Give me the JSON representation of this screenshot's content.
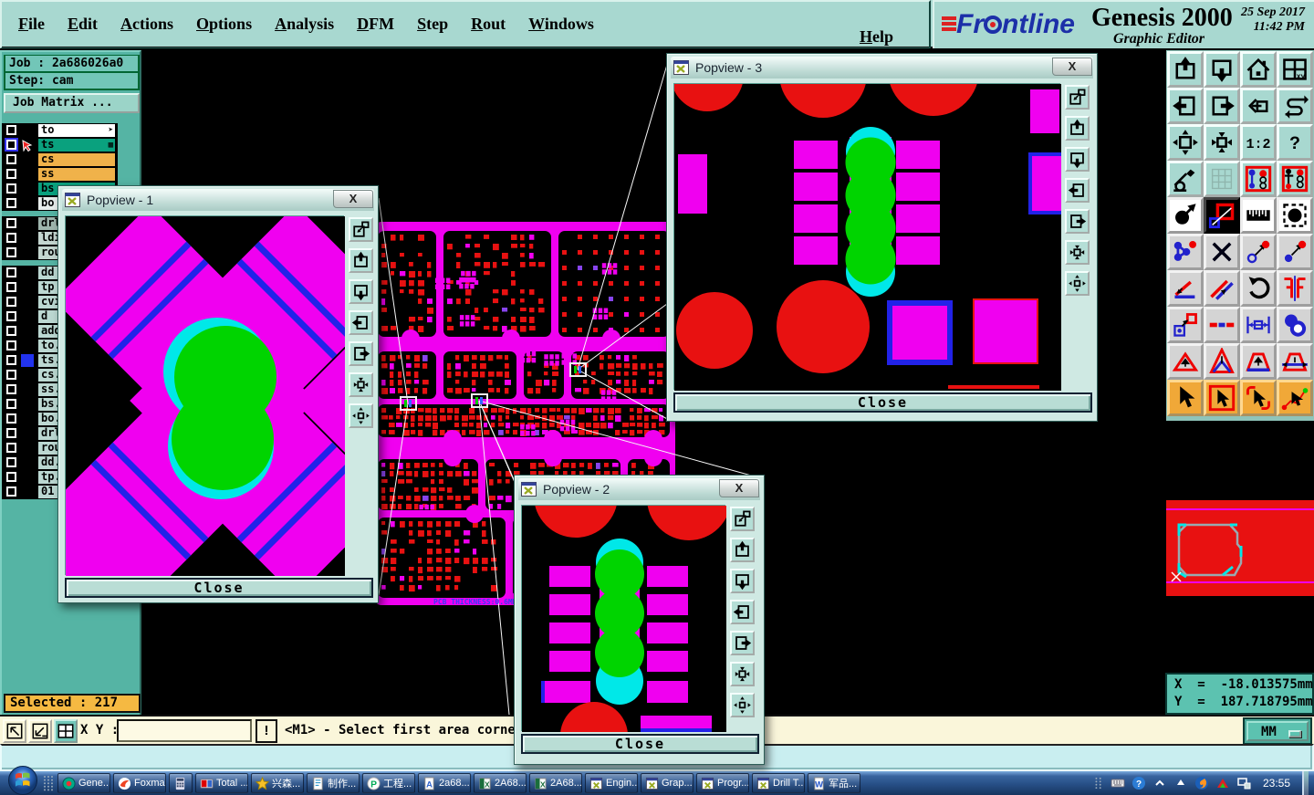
{
  "menu": {
    "items": [
      "File",
      "Edit",
      "Actions",
      "Options",
      "Analysis",
      "DFM",
      "Step",
      "Rout",
      "Windows"
    ],
    "help": "Help"
  },
  "brand": {
    "logo": "Frontline",
    "product": "Genesis 2000",
    "date": "25 Sep 2017",
    "time": "11:42 PM",
    "subtitle": "Graphic Editor"
  },
  "job": {
    "job_label": "Job : 2a686026a0",
    "step_label": "Step: cam",
    "matrix_button": "Job Matrix ..."
  },
  "layers": {
    "groups": [
      {
        "rows": [
          {
            "label": "to",
            "bg": "#ffffff",
            "right_icon": "cursor-small-icon"
          },
          {
            "label": "ts",
            "bg": "#0aa17e",
            "selected": true,
            "marker": "red-cursor",
            "right_icon": "grid-small-icon"
          },
          {
            "label": "cs",
            "bg": "#f0b24a"
          },
          {
            "label": "ss",
            "bg": "#f0b24a"
          },
          {
            "label": "bs",
            "bg": "#0aa17e"
          },
          {
            "label": "bo",
            "bg": "#e9efed"
          }
        ]
      },
      {
        "rows": [
          {
            "label": "drl",
            "bg": "#9fb6ae"
          },
          {
            "label": "ldi",
            "bg": "#c4d6d0"
          },
          {
            "label": "rou",
            "bg": "#c4d6d0"
          }
        ]
      },
      {
        "rows": [
          {
            "label": "dd",
            "bg": "#bcd8d2"
          },
          {
            "label": "tp",
            "bg": "#bcd8d2"
          },
          {
            "label": "cvi",
            "bg": "#bcd8d2"
          },
          {
            "label": "d",
            "bg": "#bcd8d2"
          },
          {
            "label": "add",
            "bg": "#bcd8d2"
          },
          {
            "label": "to.",
            "bg": "#bcd8d2"
          },
          {
            "label": "ts.",
            "bg": "#bcd8d2",
            "marker": "blue-square"
          },
          {
            "label": "cs.",
            "bg": "#bcd8d2"
          },
          {
            "label": "ss.",
            "bg": "#bcd8d2"
          },
          {
            "label": "bs.",
            "bg": "#bcd8d2"
          },
          {
            "label": "bo.",
            "bg": "#bcd8d2"
          },
          {
            "label": "drl",
            "bg": "#bcd8d2"
          },
          {
            "label": "rou",
            "bg": "#bcd8d2"
          },
          {
            "label": "dd.",
            "bg": "#bcd8d2"
          },
          {
            "label": "tp.",
            "bg": "#bcd8d2"
          },
          {
            "label": "01",
            "bg": "#bcd8d2"
          }
        ]
      }
    ]
  },
  "selected_status": "Selected : 217",
  "statusbar": {
    "xy_label": "X Y :",
    "input_value": "",
    "alert": "!",
    "message": "<M1> - Select first area corne",
    "units": "MM"
  },
  "coords": {
    "x": "X  =  -18.013575mm",
    "y": "Y  =  187.718795mm"
  },
  "pcb_note": "PCB THICKNESS:0.6MM",
  "popviews": [
    {
      "title": "Popview - 1",
      "close": "Close"
    },
    {
      "title": "Popview - 2",
      "close": "Close"
    },
    {
      "title": "Popview - 3",
      "close": "Close"
    }
  ],
  "popview_tools": [
    "popout",
    "box-arrow-up",
    "box-arrow-down",
    "box-arrow-left",
    "box-arrow-right",
    "expand-in",
    "pan-all"
  ],
  "toolbar": {
    "buttons": [
      {
        "name": "box-arrow-up",
        "bg": "teal"
      },
      {
        "name": "box-arrow-down",
        "bg": "teal"
      },
      {
        "name": "home",
        "bg": "teal"
      },
      {
        "name": "win-xy",
        "bg": "teal"
      },
      {
        "name": "box-arrow-left",
        "bg": "teal"
      },
      {
        "name": "box-arrow-right",
        "bg": "teal"
      },
      {
        "name": "undo-box",
        "bg": "teal"
      },
      {
        "name": "s-line",
        "bg": "teal"
      },
      {
        "name": "expand-out",
        "bg": "teal"
      },
      {
        "name": "expand-in",
        "bg": "teal"
      },
      {
        "name": "ratio-12",
        "bg": "teal"
      },
      {
        "name": "help-q",
        "bg": "teal"
      },
      {
        "name": "tools",
        "bg": "teal"
      },
      {
        "name": "grid9",
        "bg": "teal"
      },
      {
        "name": "traffic1",
        "bg": "teal"
      },
      {
        "name": "traffic2",
        "bg": "teal"
      },
      {
        "name": "sel-dot-arrow",
        "bg": "white"
      },
      {
        "name": "frame-meas",
        "bg": "black"
      },
      {
        "name": "ruler",
        "bg": "white"
      },
      {
        "name": "dash-sel",
        "bg": "white"
      },
      {
        "name": "chain",
        "bg": "gray"
      },
      {
        "name": "big-x",
        "bg": "gray"
      },
      {
        "name": "circ-arrow-dot",
        "bg": "gray"
      },
      {
        "name": "dot-arrow-dot",
        "bg": "gray"
      },
      {
        "name": "angle2",
        "bg": "gray"
      },
      {
        "name": "slant2",
        "bg": "gray"
      },
      {
        "name": "rotate-cw",
        "bg": "gray"
      },
      {
        "name": "mirror-ff",
        "bg": "gray"
      },
      {
        "name": "copy-sq",
        "bg": "gray"
      },
      {
        "name": "redblue-dash",
        "bg": "gray"
      },
      {
        "name": "width-meas",
        "bg": "gray"
      },
      {
        "name": "blue-blobs",
        "bg": "gray"
      },
      {
        "name": "tri-arrow",
        "bg": "gray"
      },
      {
        "name": "tri-tall",
        "bg": "gray"
      },
      {
        "name": "trap-blue",
        "bg": "gray"
      },
      {
        "name": "trap-strike",
        "bg": "gray"
      },
      {
        "name": "cursor1",
        "bg": "orange"
      },
      {
        "name": "cursor2",
        "bg": "orange"
      },
      {
        "name": "cursor3",
        "bg": "orange"
      },
      {
        "name": "cursor4",
        "bg": "orange"
      }
    ]
  },
  "taskbar": {
    "buttons": [
      {
        "label": "Gene...",
        "icon": "genesis"
      },
      {
        "label": "Foxmail",
        "icon": "foxmail"
      },
      {
        "label": "",
        "icon": "calc"
      },
      {
        "label": "Total ...",
        "icon": "totalcmd"
      },
      {
        "label": "兴森...",
        "icon": "star"
      },
      {
        "label": "制作...",
        "icon": "doc"
      },
      {
        "label": "工程...",
        "icon": "p-green"
      },
      {
        "label": "2a68...",
        "icon": "doc-a"
      },
      {
        "label": "2A68...",
        "icon": "excel"
      },
      {
        "label": "2A68...",
        "icon": "excel"
      },
      {
        "label": "Engin...",
        "icon": "xwin"
      },
      {
        "label": "Grap...",
        "icon": "xwin"
      },
      {
        "label": "Progr...",
        "icon": "xwin"
      },
      {
        "label": "Drill T...",
        "icon": "xwin"
      },
      {
        "label": "军品...",
        "icon": "word"
      }
    ],
    "tray": [
      "keyboard",
      "help-circle",
      "caret-down",
      "up-arrow",
      "flame",
      "cad-tri",
      "network"
    ],
    "clock": "23:55"
  },
  "colors": {
    "magenta": "#f000f0",
    "red": "#e81111",
    "green": "#00d400",
    "cyan": "#00e8e8",
    "blue": "#2222e8",
    "teal_panel": "#55b4a4",
    "bar": "#a8d8d0",
    "orange_box": "#f5b942",
    "pale_yellow": "#faf6da"
  }
}
